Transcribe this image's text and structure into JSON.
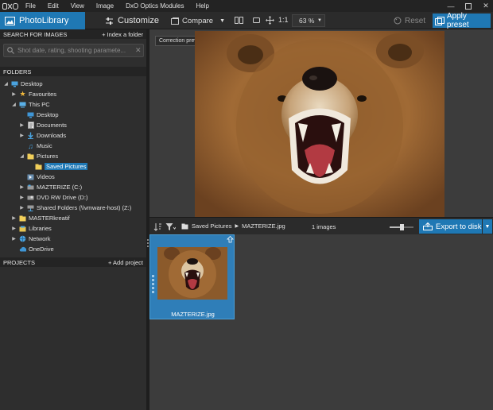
{
  "menubar": {
    "logo": "DxO",
    "items": [
      "File",
      "Edit",
      "View",
      "Image",
      "DxO Optics Modules",
      "Help"
    ],
    "window_controls": [
      "minimize-icon",
      "maximize-icon",
      "close-icon"
    ]
  },
  "toolbar": {
    "photolibrary_label": "PhotoLibrary",
    "customize_label": "Customize",
    "compare_label": "Compare",
    "ratio_label": "1:1",
    "zoom_value": "63 %",
    "reset_label": "Reset",
    "apply_preset_label": "Apply preset",
    "accent_color": "#1f78b4"
  },
  "search": {
    "header": "SEARCH FOR IMAGES",
    "action": "+ Index a folder",
    "placeholder": "Shot date, rating, shooting paramete..."
  },
  "folders": {
    "header": "FOLDERS",
    "items": [
      {
        "label": "Desktop",
        "icon": "desktop-icon"
      },
      {
        "label": "Favourites",
        "icon": "star-icon"
      },
      {
        "label": "This PC",
        "icon": "computer-icon"
      },
      {
        "label": "Desktop",
        "icon": "desktop-icon"
      },
      {
        "label": "Documents",
        "icon": "documents-icon"
      },
      {
        "label": "Downloads",
        "icon": "download-icon"
      },
      {
        "label": "Music",
        "icon": "music-icon"
      },
      {
        "label": "Pictures",
        "icon": "folder-icon"
      },
      {
        "label": "Saved Pictures",
        "icon": "folder-icon"
      },
      {
        "label": "Videos",
        "icon": "video-icon"
      },
      {
        "label": "MAZTERIZE (C:)",
        "icon": "drive-icon"
      },
      {
        "label": "DVD RW Drive (D:)",
        "icon": "dvd-icon"
      },
      {
        "label": "Shared Folders (\\\\vmware-host) (Z:)",
        "icon": "network-drive-icon"
      },
      {
        "label": "MASTERkreatif",
        "icon": "folder-icon"
      },
      {
        "label": "Libraries",
        "icon": "libraries-icon"
      },
      {
        "label": "Network",
        "icon": "network-icon"
      },
      {
        "label": "OneDrive",
        "icon": "cloud-icon"
      }
    ]
  },
  "projects": {
    "header": "PROJECTS",
    "action": "+ Add project"
  },
  "viewer": {
    "tooltip": "Correction preview"
  },
  "filmstrip": {
    "path": [
      "Saved Pictures",
      "MAZTERIZE.jpg"
    ],
    "image_count": "1 images",
    "thumbnail_size": 0.5,
    "export_label": "Export to disk",
    "thumbnails": [
      {
        "name": "MAZTERIZE.jpg"
      }
    ]
  }
}
